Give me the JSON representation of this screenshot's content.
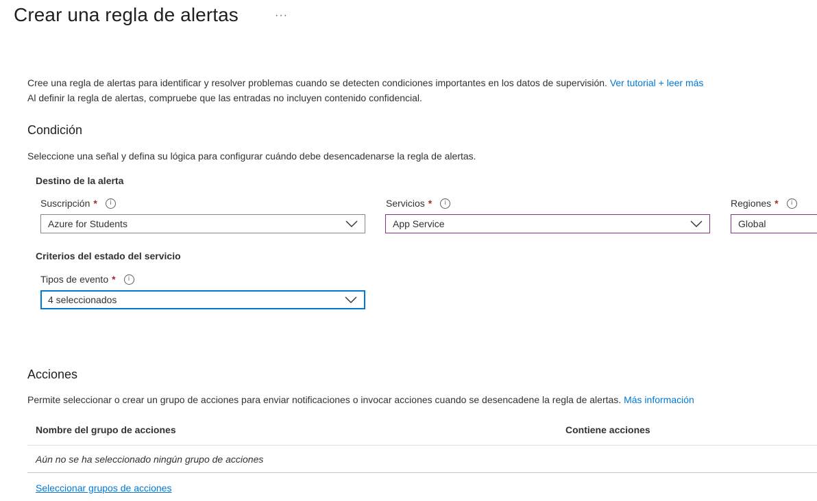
{
  "page": {
    "title": "Crear una regla de alertas",
    "more_label": "···"
  },
  "intro": {
    "line1": "Cree una regla de alertas para identificar y resolver problemas cuando se detecten condiciones importantes en los datos de supervisión.",
    "tutorial_link": "Ver tutorial + leer más",
    "line2": "Al definir la regla de alertas, compruebe que las entradas no incluyen contenido confidencial."
  },
  "condition": {
    "title": "Condición",
    "description": "Seleccione una señal y defina su lógica para configurar cuándo debe desencadenarse la regla de alertas.",
    "target_heading": "Destino de la alerta",
    "subscription": {
      "label": "Suscripción",
      "required": "*",
      "value": "Azure for Students"
    },
    "services": {
      "label": "Servicios",
      "required": "*",
      "value": "App Service"
    },
    "regions": {
      "label": "Regiones",
      "required": "*",
      "value": "Global"
    },
    "criteria_heading": "Criterios del estado del servicio",
    "event_types": {
      "label": "Tipos de evento",
      "required": "*",
      "value": "4 seleccionados"
    }
  },
  "actions": {
    "title": "Acciones",
    "description": "Permite seleccionar o crear un grupo de acciones para enviar notificaciones o invocar acciones cuando se desencadene la regla de alertas.",
    "more_info_link": "Más información",
    "table": {
      "columns": [
        "Nombre del grupo de acciones",
        "Contiene acciones"
      ],
      "empty_message": "Aún no se ha seleccionado ningún grupo de acciones"
    },
    "select_link": "Seleccionar grupos de acciones"
  },
  "icons": {
    "info": "info-icon",
    "chevron": "chevron-down-icon",
    "more": "more-icon"
  },
  "colors": {
    "link": "#0078d4",
    "required": "#a4262c",
    "focus_border": "#0078d4",
    "invalid_border": "#8a2c8a"
  }
}
